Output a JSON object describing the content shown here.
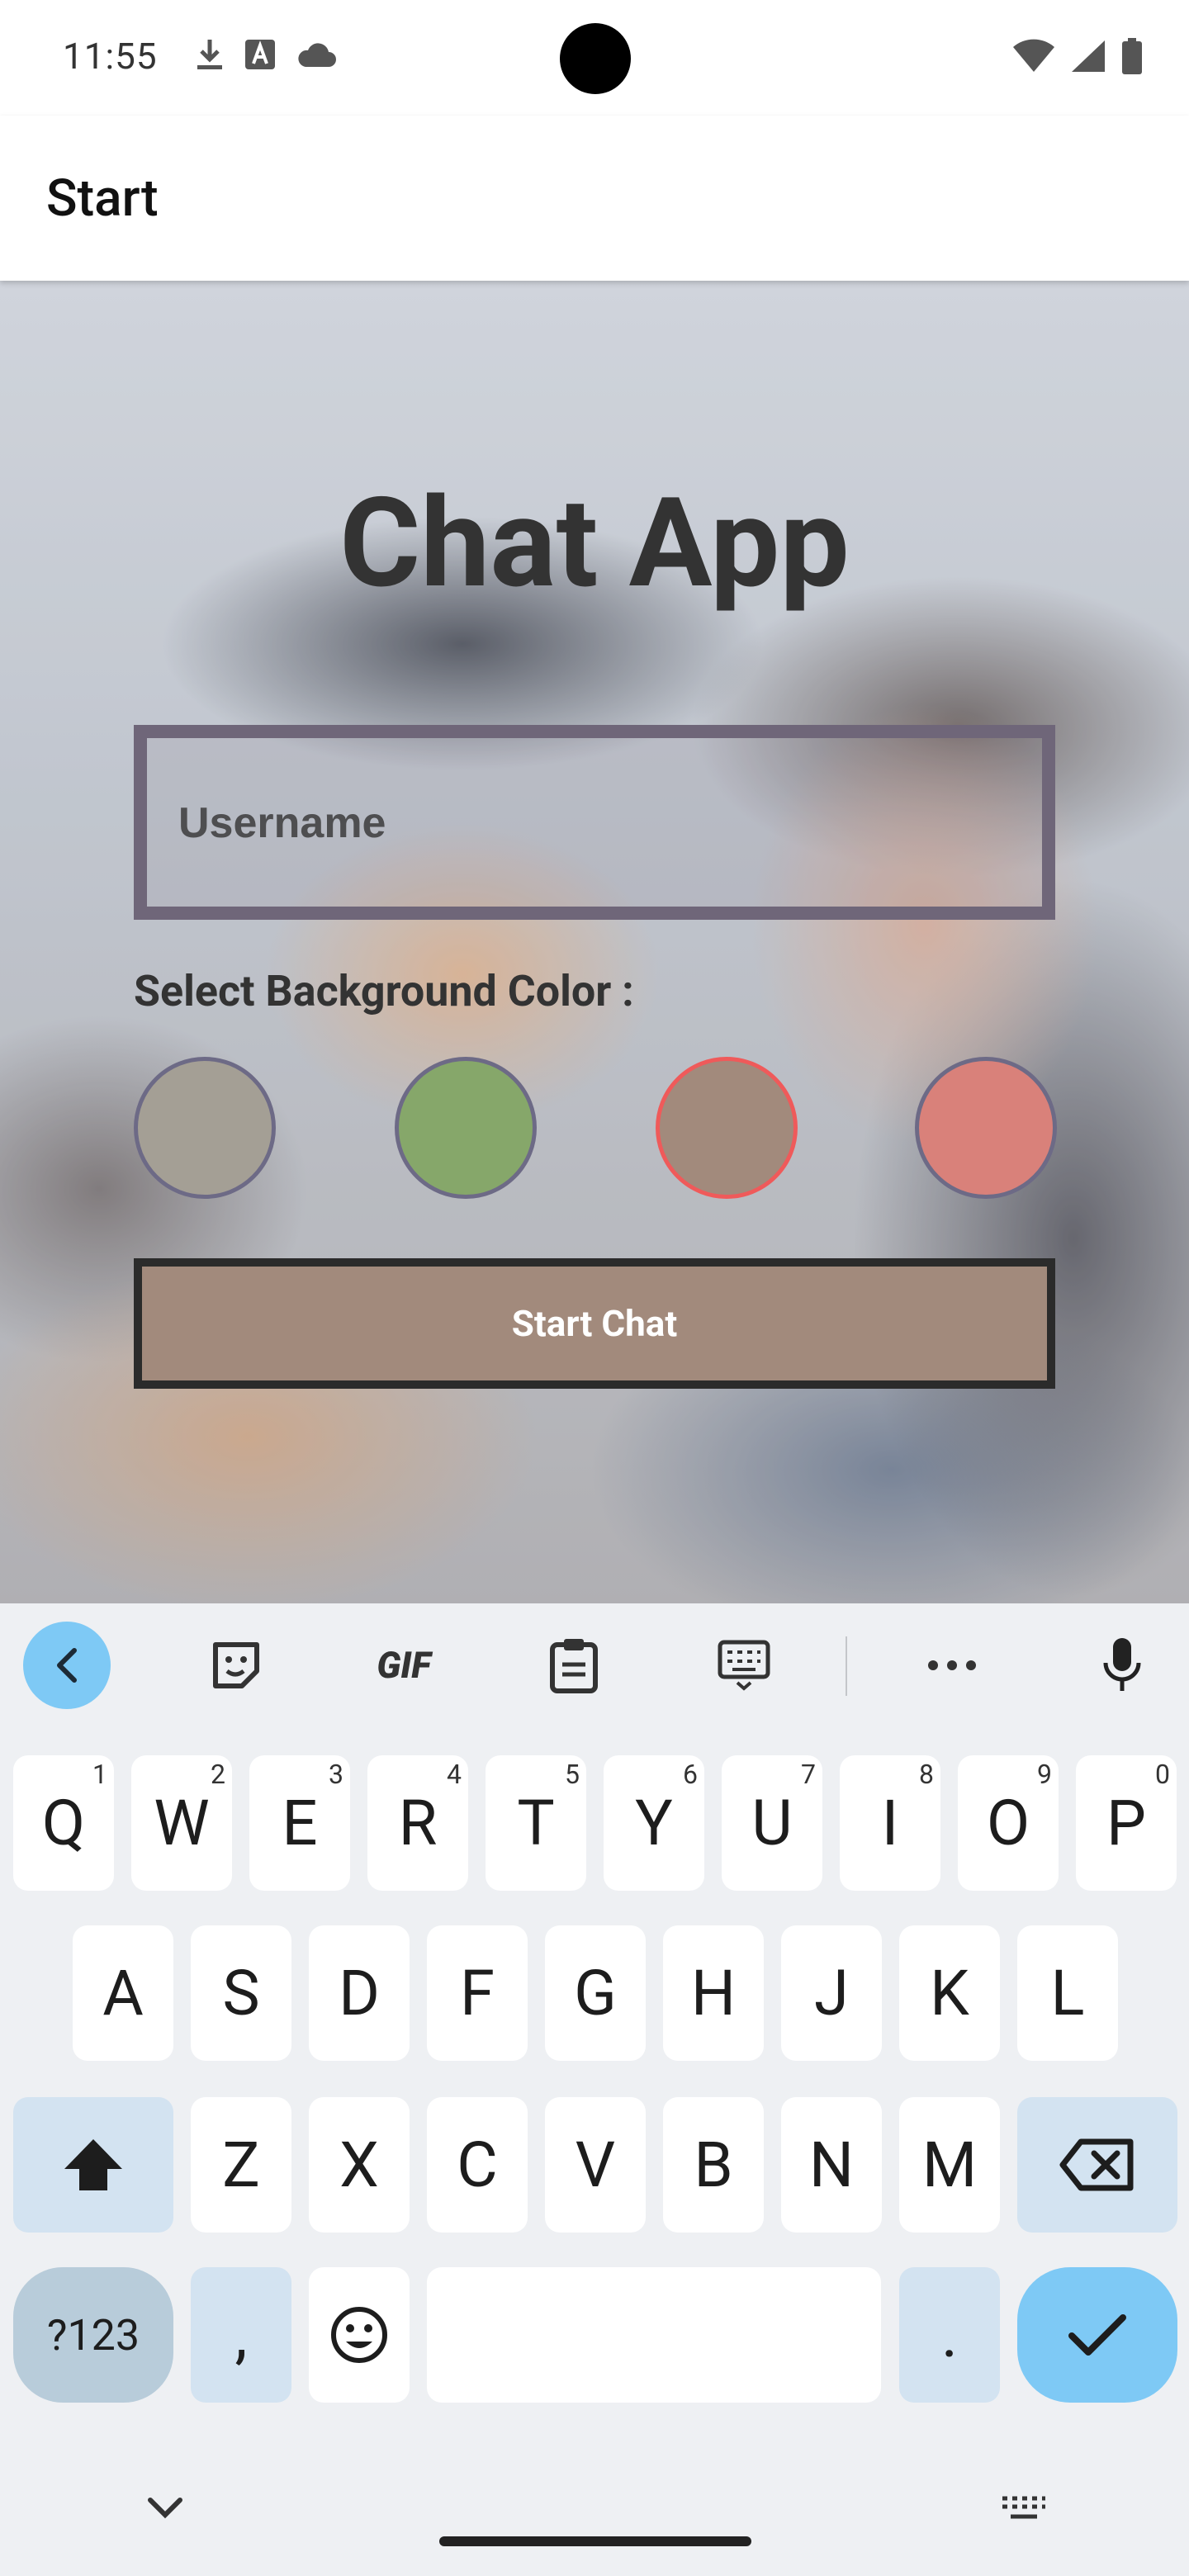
{
  "status_bar": {
    "time": "11:55",
    "left_icons": [
      "download-icon",
      "font-a-icon",
      "cloud-icon"
    ],
    "right_icons": [
      "wifi-icon",
      "signal-icon",
      "battery-icon"
    ]
  },
  "app_bar": {
    "title": "Start"
  },
  "screen": {
    "title": "Chat App",
    "username": {
      "value": "",
      "placeholder": "Username"
    },
    "color_label": "Select Background Color :",
    "swatches": [
      {
        "color": "#a49f95",
        "selected": false
      },
      {
        "color": "#86a76a",
        "selected": false
      },
      {
        "color": "#a28a7c",
        "selected": true
      },
      {
        "color": "#d9817a",
        "selected": false
      }
    ],
    "start_button": {
      "label": "Start Chat",
      "color": "#a28a7c"
    }
  },
  "keyboard": {
    "toolbar": [
      "back-chevron-icon",
      "sticker-icon",
      "GIF",
      "clipboard-icon",
      "keyboard-icon",
      "more-icon",
      "mic-icon"
    ],
    "row1": [
      {
        "k": "Q",
        "h": "1"
      },
      {
        "k": "W",
        "h": "2"
      },
      {
        "k": "E",
        "h": "3"
      },
      {
        "k": "R",
        "h": "4"
      },
      {
        "k": "T",
        "h": "5"
      },
      {
        "k": "Y",
        "h": "6"
      },
      {
        "k": "U",
        "h": "7"
      },
      {
        "k": "I",
        "h": "8"
      },
      {
        "k": "O",
        "h": "9"
      },
      {
        "k": "P",
        "h": "0"
      }
    ],
    "row2": [
      "A",
      "S",
      "D",
      "F",
      "G",
      "H",
      "J",
      "K",
      "L"
    ],
    "row3": [
      "Z",
      "X",
      "C",
      "V",
      "B",
      "N",
      "M"
    ],
    "symbols_label": "?123",
    "comma": ",",
    "period": ".",
    "accent_color": "#7ec9f5"
  }
}
